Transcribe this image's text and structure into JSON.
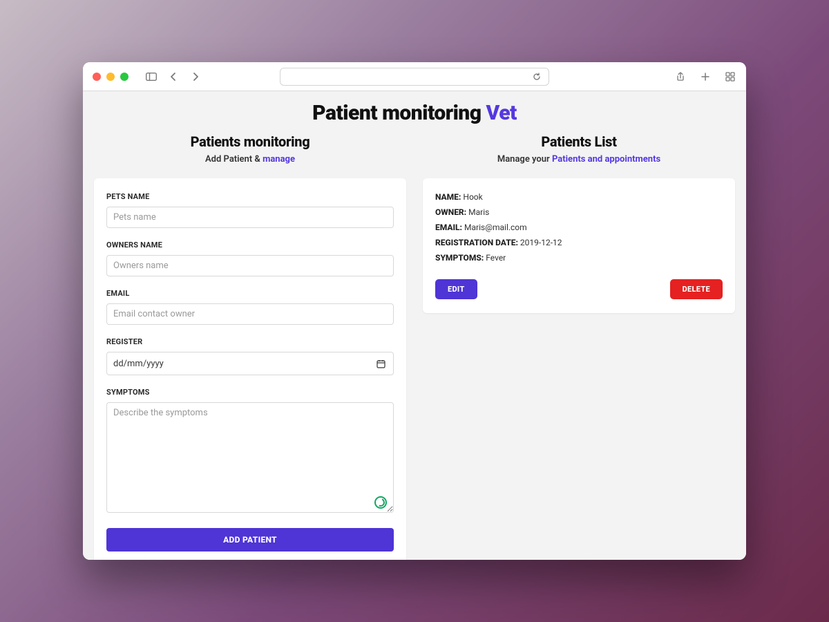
{
  "page": {
    "title_main": "Patient monitoring",
    "title_accent": "Vet"
  },
  "form_panel": {
    "heading": "Patients monitoring",
    "sub_prefix": "Add Patient & ",
    "sub_accent": "manage",
    "fields": {
      "pet_name": {
        "label": "PETS NAME",
        "placeholder": "Pets name",
        "value": ""
      },
      "owner_name": {
        "label": "OWNERS NAME",
        "placeholder": "Owners name",
        "value": ""
      },
      "email": {
        "label": "EMAIL",
        "placeholder": "Email contact owner",
        "value": ""
      },
      "register": {
        "label": "REGISTER",
        "placeholder": "dd/mm/yyyy",
        "value": ""
      },
      "symptoms": {
        "label": "SYMPTOMS",
        "placeholder": "Describe the symptoms",
        "value": ""
      }
    },
    "submit_label": "ADD PATIENT"
  },
  "list_panel": {
    "heading": "Patients List",
    "sub_prefix": "Manage your ",
    "sub_accent": "Patients and appointments",
    "labels": {
      "name": "NAME:",
      "owner": "OWNER:",
      "email": "EMAIL:",
      "reg_date": "REGISTRATION DATE:",
      "symptoms": "SYMPTOMS:"
    },
    "patient": {
      "name": "Hook",
      "owner": "Maris",
      "email": "Maris@mail.com",
      "reg_date": "2019-12-12",
      "symptoms": "Fever"
    },
    "edit_label": "EDIT",
    "delete_label": "DELETE"
  }
}
